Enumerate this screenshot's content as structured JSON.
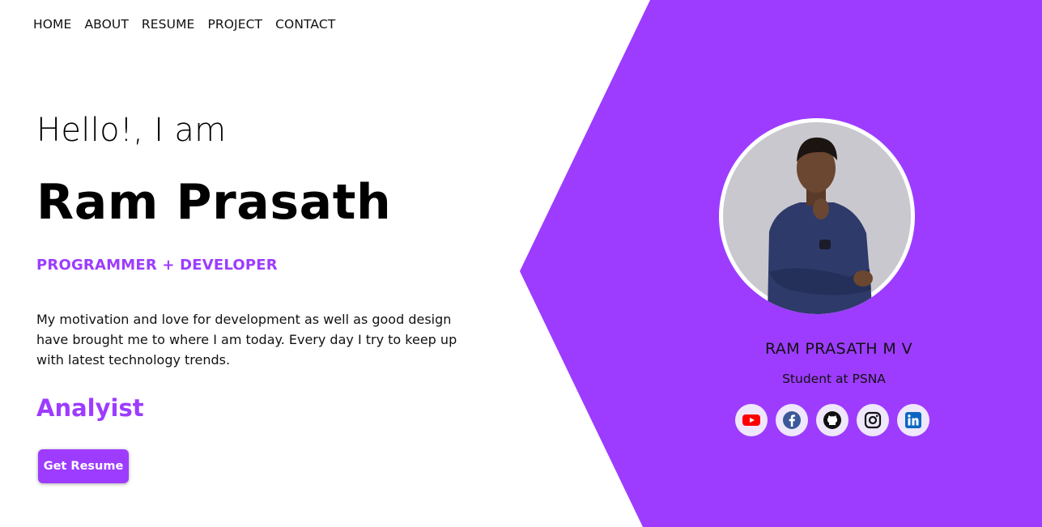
{
  "nav": {
    "items": [
      "HOME",
      "ABOUT",
      "RESUME",
      "PROJECT",
      "CONTACT"
    ]
  },
  "hero": {
    "greeting": "Hello!, I am",
    "name": "Ram Prasath",
    "role": "PROGRAMMER + DEVELOPER",
    "bio": "My motivation and love for development as well as good design have brought me to where I am today. Every day I try to keep up with latest technology trends.",
    "typed_text": "Analyist",
    "resume_button": "Get Resume"
  },
  "profile": {
    "name": "RAM PRASATH M V",
    "subtitle": "Student at PSNA",
    "photo_alt": "profile photo"
  },
  "socials": [
    {
      "icon": "youtube-icon",
      "color": "#ff0000"
    },
    {
      "icon": "facebook-icon",
      "color": "#3b5998"
    },
    {
      "icon": "github-icon",
      "color": "#111111"
    },
    {
      "icon": "instagram-icon",
      "color": "#111111"
    },
    {
      "icon": "linkedin-icon",
      "color": "#0a66c2"
    }
  ],
  "colors": {
    "accent": "#9d3cff",
    "background": "#ffffff",
    "social_bg": "#efe7fb"
  }
}
